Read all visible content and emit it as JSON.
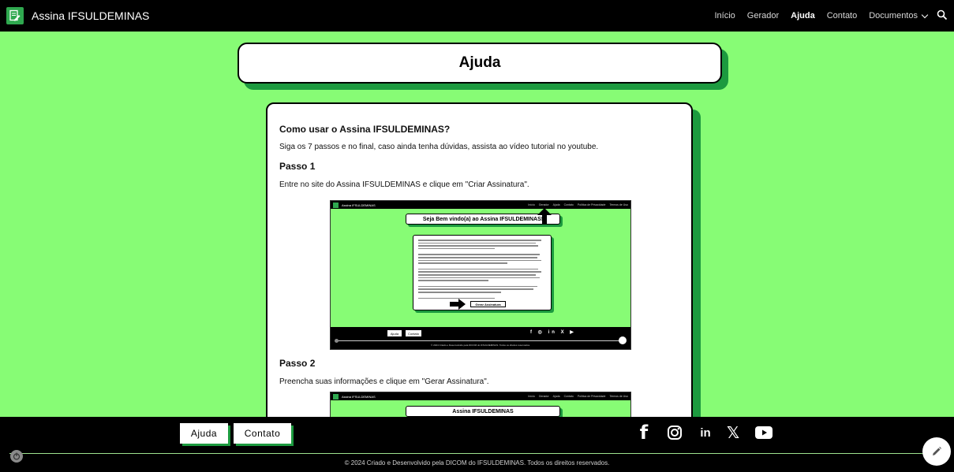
{
  "navbar": {
    "brand": "Assina IFSULDEMINAS",
    "links": [
      "Início",
      "Gerador",
      "Ajuda",
      "Contato",
      "Documentos"
    ],
    "active": "Ajuda"
  },
  "page": {
    "title": "Ajuda",
    "heading": "Como usar o Assina IFSULDEMINAS?",
    "intro": "Siga os 7 passos e no final, caso ainda tenha dúvidas, assista ao vídeo tutorial no youtube.",
    "steps": [
      {
        "title": "Passo 1",
        "text": "Entre no site do Assina IFSULDEMINAS e clique em \"Criar Assinatura\"."
      },
      {
        "title": "Passo 2",
        "text": "Preencha suas informações e clique em \"Gerar Assinatura\"."
      }
    ]
  },
  "screenshots": {
    "step1": {
      "brand": "Assina IFSULDEMINAS",
      "links": [
        "Início",
        "Gerador",
        "Ajuda",
        "Contato",
        "Política de Privacidade",
        "Termos de Uso"
      ],
      "banner": "Seja Bem vindo(a) ao Assina IFSULDEMINAS!",
      "button": "Gerar Assinatura",
      "footer_buttons": [
        "Ajuda",
        "Contato"
      ],
      "footer_icons": "f ◎ in X ▶",
      "copyright": "© 2024 Criado e Desenvolvido pela DICOM do IFSULDEMINAS. Todos os direitos reservados."
    },
    "step2": {
      "brand": "Assina IFSULDEMINAS",
      "links": [
        "Início",
        "Gerador",
        "Ajuda",
        "Contato",
        "Política de Privacidade",
        "Termos de Uso"
      ],
      "banner": "Assina IFSULDEMINAS"
    }
  },
  "footer": {
    "buttons": [
      "Ajuda",
      "Contato"
    ],
    "social": {
      "facebook": "f",
      "linkedin": "in",
      "x": "𝕏"
    },
    "copyright": "© 2024 Criado e Desenvolvido pela DICOM do IFSULDEMINAS. Todos os direitos reservados."
  },
  "colors": {
    "background": "#87fc75",
    "shadow": "#1c9a3f",
    "navbar": "#000000"
  }
}
